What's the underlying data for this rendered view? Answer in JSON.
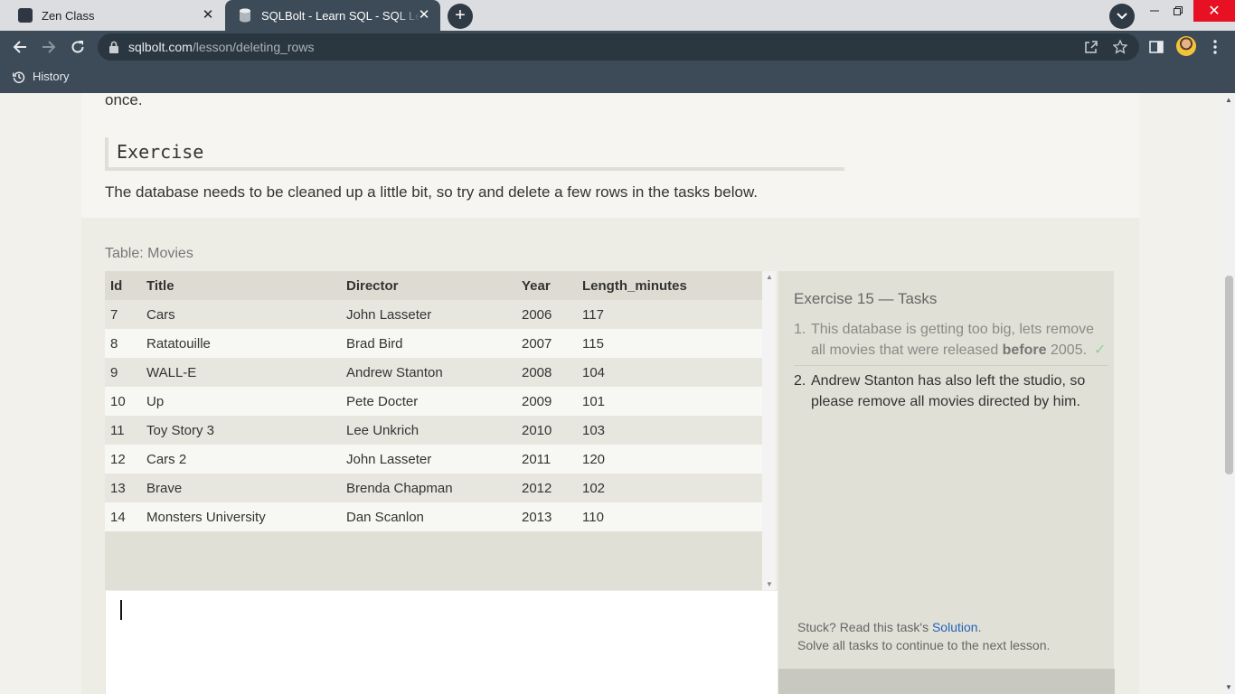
{
  "browser": {
    "tabs": [
      {
        "title": "Zen Class",
        "active": false
      },
      {
        "title": "SQLBolt - Learn SQL - SQL Lesson",
        "active": true
      }
    ],
    "url_domain": "sqlbolt.com",
    "url_path": "/lesson/deleting_rows",
    "bookmarks": [
      {
        "label": "History",
        "icon": "history-icon"
      }
    ],
    "colors": {
      "chrome": "#3c4b57",
      "tabbar": "#dcdde0",
      "close_hover": "#e81123"
    }
  },
  "lesson": {
    "prev_text_fragment": "once.",
    "exercise_heading": "Exercise",
    "exercise_description": "The database needs to be cleaned up a little bit, so try and delete a few rows in the tasks below."
  },
  "table": {
    "label": "Table: Movies",
    "columns": [
      "Id",
      "Title",
      "Director",
      "Year",
      "Length_minutes"
    ],
    "rows": [
      [
        "7",
        "Cars",
        "John Lasseter",
        "2006",
        "117"
      ],
      [
        "8",
        "Ratatouille",
        "Brad Bird",
        "2007",
        "115"
      ],
      [
        "9",
        "WALL-E",
        "Andrew Stanton",
        "2008",
        "104"
      ],
      [
        "10",
        "Up",
        "Pete Docter",
        "2009",
        "101"
      ],
      [
        "11",
        "Toy Story 3",
        "Lee Unkrich",
        "2010",
        "103"
      ],
      [
        "12",
        "Cars 2",
        "John Lasseter",
        "2011",
        "120"
      ],
      [
        "13",
        "Brave",
        "Brenda Chapman",
        "2012",
        "102"
      ],
      [
        "14",
        "Monsters University",
        "Dan Scanlon",
        "2013",
        "110"
      ]
    ]
  },
  "editor": {
    "value": ""
  },
  "tasks": {
    "title": "Exercise 15 — Tasks",
    "items": [
      {
        "num": "1.",
        "pre": "This database is getting too big, lets remove all movies that were released ",
        "bold": "before",
        "post": " 2005.",
        "done": true,
        "check": "✓"
      },
      {
        "num": "2.",
        "text": "Andrew Stanton has also left the studio, so please remove all movies directed by him.",
        "done": false
      }
    ],
    "stuck_prefix": "Stuck? Read this task's ",
    "solution_link": "Solution",
    "stuck_suffix": ".",
    "continue_text": "Solve all tasks to continue to the next lesson."
  }
}
